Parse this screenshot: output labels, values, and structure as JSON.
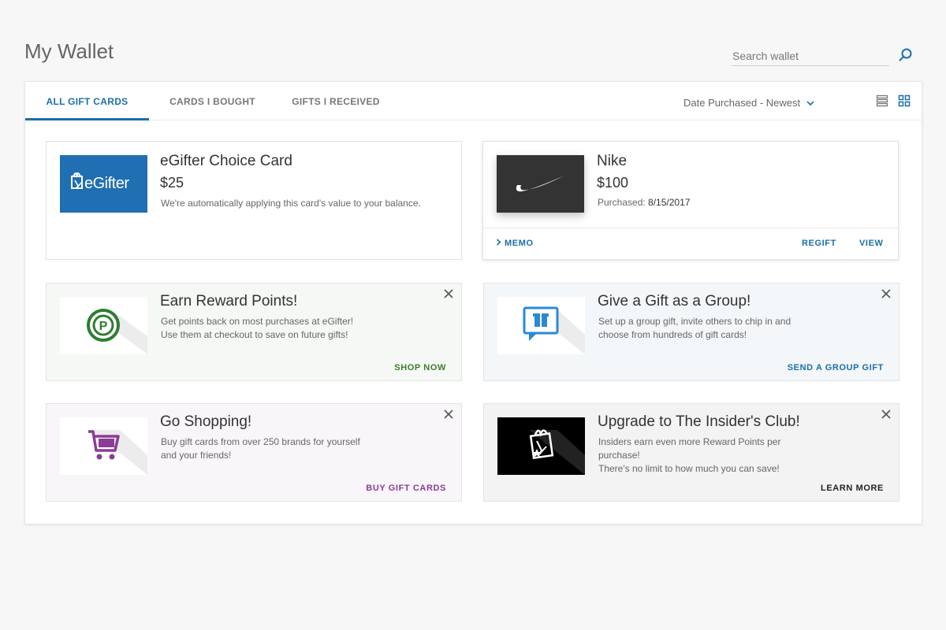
{
  "page": {
    "title": "My Wallet"
  },
  "search": {
    "placeholder": "Search wallet",
    "icon": "search-icon"
  },
  "tabs": [
    {
      "label": "ALL GIFT CARDS",
      "active": true
    },
    {
      "label": "CARDS I BOUGHT",
      "active": false
    },
    {
      "label": "GIFTS I RECEIVED",
      "active": false
    }
  ],
  "sort": {
    "selected": "Date Purchased - Newest",
    "icon": "chevron-down-icon"
  },
  "view": {
    "list_icon": "list-view-icon",
    "grid_icon": "grid-view-icon",
    "selected": "grid"
  },
  "cards": [
    {
      "brand_logo_text": "eGifter",
      "title": "eGifter Choice Card",
      "amount": "$25",
      "description": "We're automatically applying this card's value to your balance."
    },
    {
      "title": "Nike",
      "amount": "$100",
      "purchased_label": "Purchased:",
      "purchased_date": "8/15/2017",
      "memo_label": "MEMO",
      "regift_label": "REGIFT",
      "view_label": "VIEW"
    }
  ],
  "promos": [
    {
      "title": "Earn Reward Points!",
      "desc_line1": "Get points back on most purchases at eGifter!",
      "desc_line2": "Use them at checkout to save on future gifts!",
      "cta": "SHOP NOW",
      "cta_color": "#3a7d2c",
      "bg": "#f6f8f5",
      "icon": "reward-points-icon"
    },
    {
      "title": "Give a Gift as a Group!",
      "desc_line1": "Set up a group gift, invite others to chip in and",
      "desc_line2": "choose from hundreds of gift cards!",
      "cta": "SEND A GROUP GIFT",
      "cta_color": "#1a6fa8",
      "bg": "#f3f7fa",
      "icon": "group-gift-icon"
    },
    {
      "title": "Go Shopping!",
      "desc_line1": "Buy gift cards from over 250 brands for yourself",
      "desc_line2": "and your friends!",
      "cta": "BUY GIFT CARDS",
      "cta_color": "#8b3d96",
      "bg": "#f8f6f9",
      "icon": "shopping-cart-icon"
    },
    {
      "title": "Upgrade to The Insider's Club!",
      "desc_line1": "Insiders earn even more Reward Points per purchase!",
      "desc_line2": "There's no limit to how much you can save!",
      "cta": "LEARN MORE",
      "cta_color": "#222222",
      "bg": "#f3f3f3",
      "icon": "insiders-club-icon"
    }
  ],
  "colors": {
    "accent": "#1a6fa8",
    "egifter_blue": "#1f6fb2",
    "nike_bg": "#333333"
  }
}
